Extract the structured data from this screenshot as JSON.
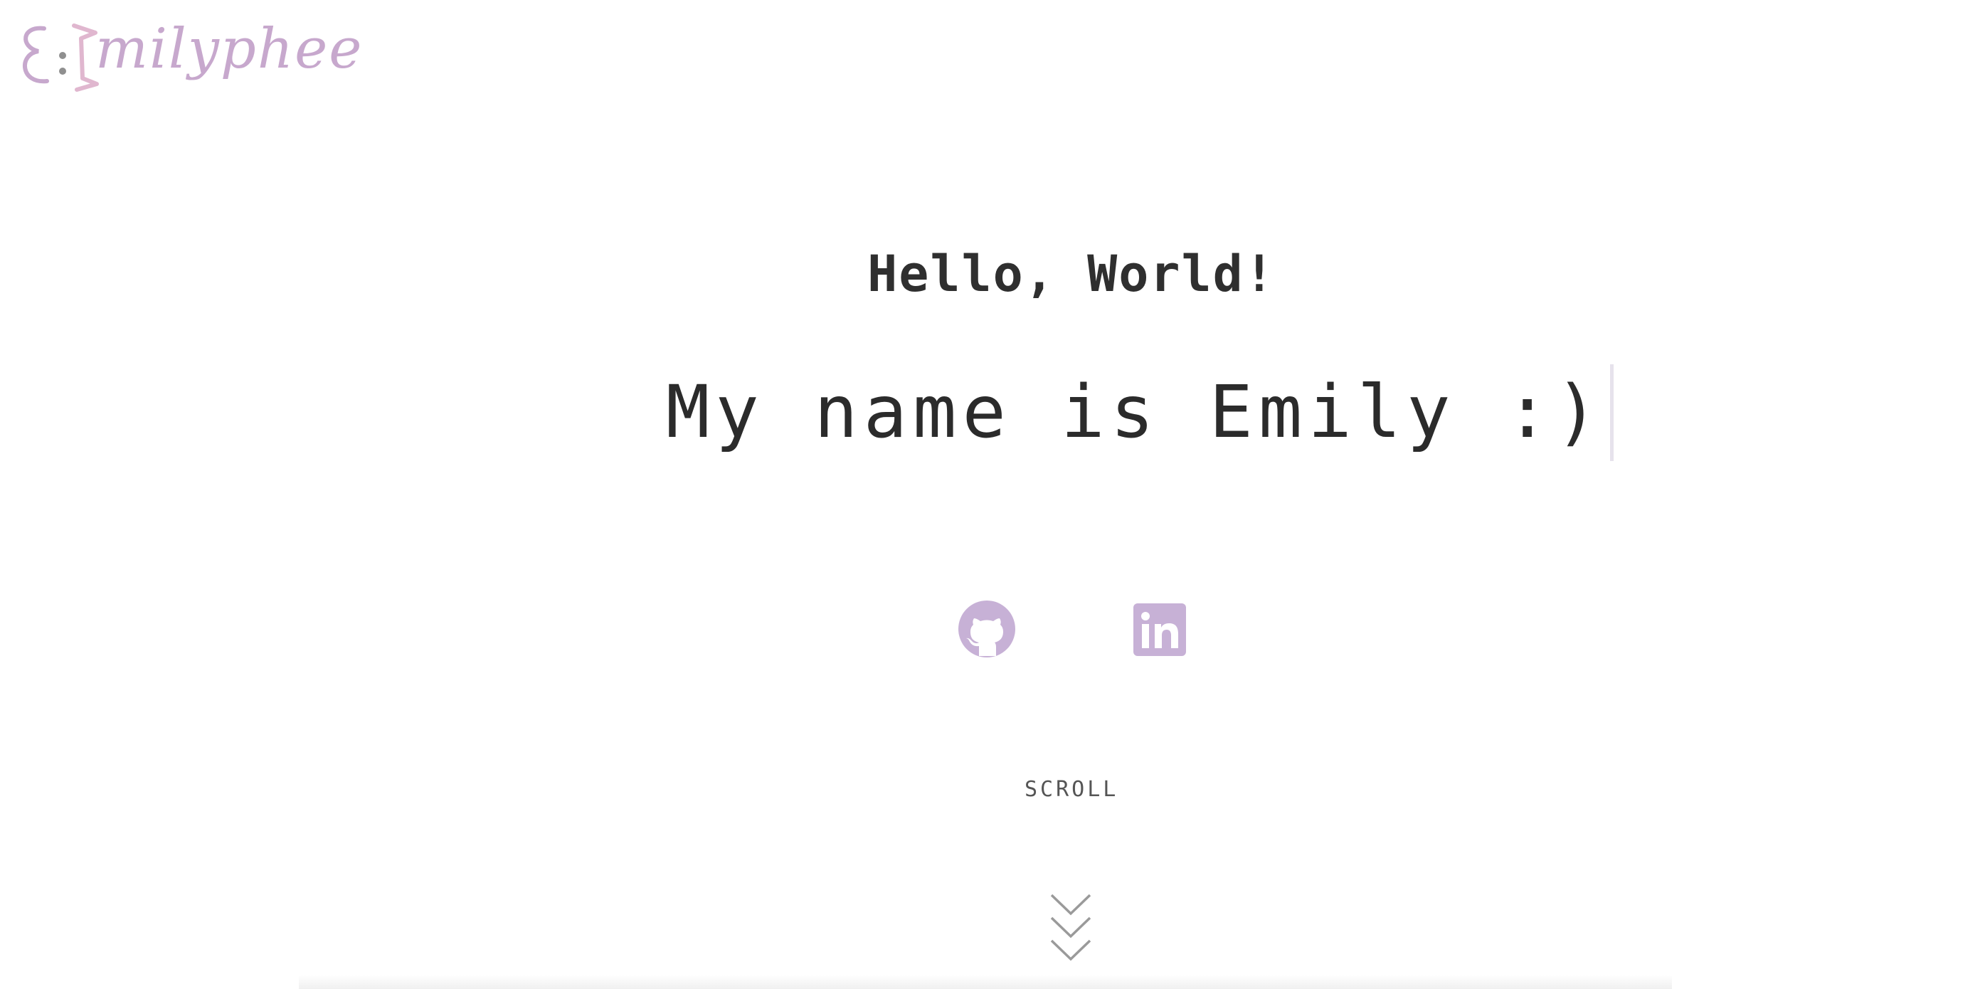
{
  "logo": {
    "face": "Ɛ:",
    "text": "milyphee",
    "color": "#c7a8cd"
  },
  "hero": {
    "greeting": "Hello, World!",
    "intro": "My name is Emily :)"
  },
  "social": [
    {
      "name": "GitHub",
      "icon": "github-icon",
      "color": "#c7b1d6"
    },
    {
      "name": "LinkedIn",
      "icon": "linkedin-icon",
      "color": "#c7b1d6"
    }
  ],
  "scroll": {
    "label": "SCROLL",
    "icon": "chevrons-down-icon",
    "color": "#9a9a9a"
  }
}
